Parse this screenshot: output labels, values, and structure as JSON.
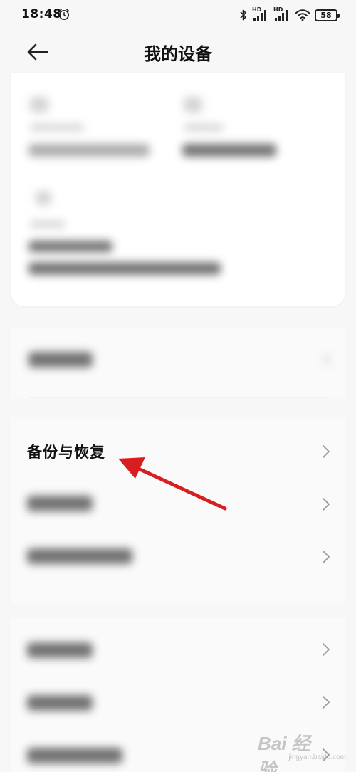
{
  "status_bar": {
    "time": "18:48",
    "network_label_1": "HD",
    "network_label_2": "HD",
    "battery": "58"
  },
  "header": {
    "title": "我的设备"
  },
  "menu": {
    "backup_restore_label": "备份与恢复"
  },
  "watermark": {
    "text": "Bai 经验",
    "sub": "jingyan.baidu.com"
  },
  "colors": {
    "annotation_arrow": "#e02020",
    "background": "#f7f7f7",
    "card": "#ffffff"
  }
}
